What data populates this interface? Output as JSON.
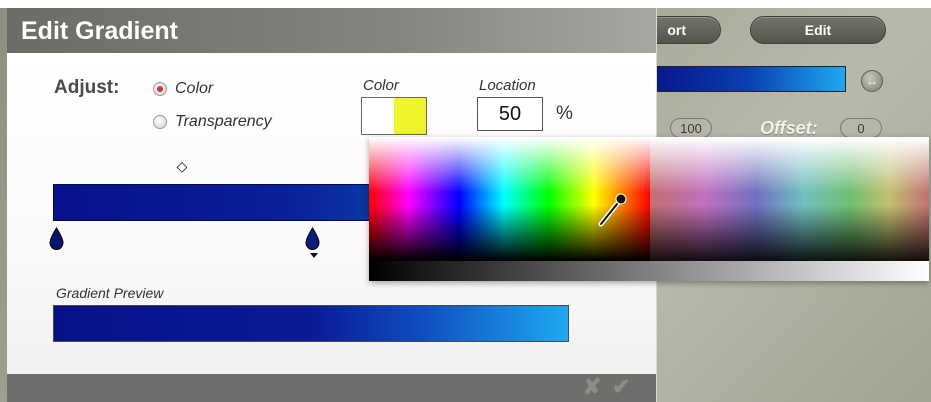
{
  "background_panel": {
    "import_button_label": "ort",
    "edit_button_label": "Edit",
    "swap_icon": "swap-arrows-icon",
    "field_100": "100",
    "offset_label": "Offset:",
    "field_0": "0"
  },
  "dialog": {
    "title": "Edit Gradient",
    "adjust_label": "Adjust:",
    "adjust_options": [
      {
        "label": "Color",
        "selected": true
      },
      {
        "label": "Transparency",
        "selected": false
      }
    ],
    "color_caption": "Color",
    "color_value": "#eef52a",
    "location_caption": "Location",
    "location_value": "50",
    "percent_symbol": "%",
    "gradient_preview_label": "Gradient Preview",
    "gradient": {
      "start_color": "#07108a",
      "end_color": "#1ea9f0"
    },
    "footer": {
      "cancel_icon": "x-icon",
      "ok_icon": "checkmark-icon"
    }
  },
  "color_picker": {
    "eyedropper_icon": "eyedropper-icon"
  }
}
